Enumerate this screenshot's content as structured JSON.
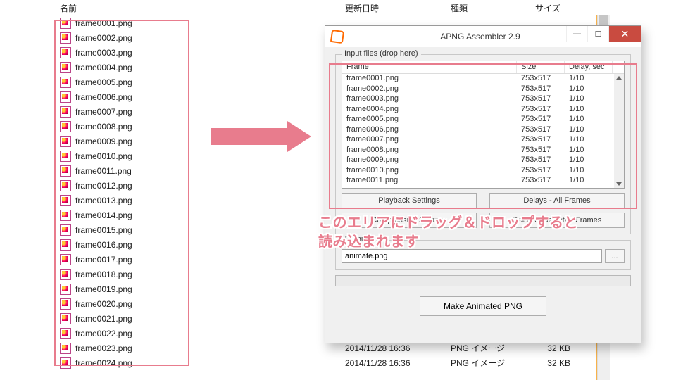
{
  "explorer": {
    "columns": {
      "name": "名前",
      "date": "更新日時",
      "type": "種類",
      "size": "サイズ"
    },
    "files": [
      "frame0001.png",
      "frame0002.png",
      "frame0003.png",
      "frame0004.png",
      "frame0005.png",
      "frame0006.png",
      "frame0007.png",
      "frame0008.png",
      "frame0009.png",
      "frame0010.png",
      "frame0011.png",
      "frame0012.png",
      "frame0013.png",
      "frame0014.png",
      "frame0015.png",
      "frame0016.png",
      "frame0017.png",
      "frame0018.png",
      "frame0019.png",
      "frame0020.png",
      "frame0021.png",
      "frame0022.png",
      "frame0023.png",
      "frame0024.png"
    ],
    "detail_date": "2014/11/28 16:36",
    "detail_type": "PNG イメージ",
    "detail_size": "32 KB"
  },
  "callout": {
    "line1": "このエリアにドラッグ＆ドロップすると",
    "line2": "読み込まれます"
  },
  "apng": {
    "title": "APNG Assembler 2.9",
    "input_label": "Input files (drop here)",
    "columns": {
      "frame": "Frame",
      "size": "Size",
      "delay": "Delay, sec"
    },
    "rows": [
      {
        "frame": "frame0001.png",
        "size": "753x517",
        "delay": "1/10"
      },
      {
        "frame": "frame0002.png",
        "size": "753x517",
        "delay": "1/10"
      },
      {
        "frame": "frame0003.png",
        "size": "753x517",
        "delay": "1/10"
      },
      {
        "frame": "frame0004.png",
        "size": "753x517",
        "delay": "1/10"
      },
      {
        "frame": "frame0005.png",
        "size": "753x517",
        "delay": "1/10"
      },
      {
        "frame": "frame0006.png",
        "size": "753x517",
        "delay": "1/10"
      },
      {
        "frame": "frame0007.png",
        "size": "753x517",
        "delay": "1/10"
      },
      {
        "frame": "frame0008.png",
        "size": "753x517",
        "delay": "1/10"
      },
      {
        "frame": "frame0009.png",
        "size": "753x517",
        "delay": "1/10"
      },
      {
        "frame": "frame0010.png",
        "size": "753x517",
        "delay": "1/10"
      },
      {
        "frame": "frame0011.png",
        "size": "753x517",
        "delay": "1/10"
      }
    ],
    "buttons": {
      "playback": "Playback Settings",
      "delays_all": "Delays - All Frames",
      "compression": "Compression Settings",
      "delays_sel": "Delays - Selected Frames"
    },
    "output_label": "Output file",
    "output_value": "animate.png",
    "browse": "...",
    "make": "Make Animated PNG",
    "winbtns": {
      "min": "—",
      "max": "☐",
      "close": "✕"
    }
  },
  "colors": {
    "accent_pink": "#e87c8d",
    "win_close": "#c94b40",
    "orange_strip": "#f8b24a"
  }
}
